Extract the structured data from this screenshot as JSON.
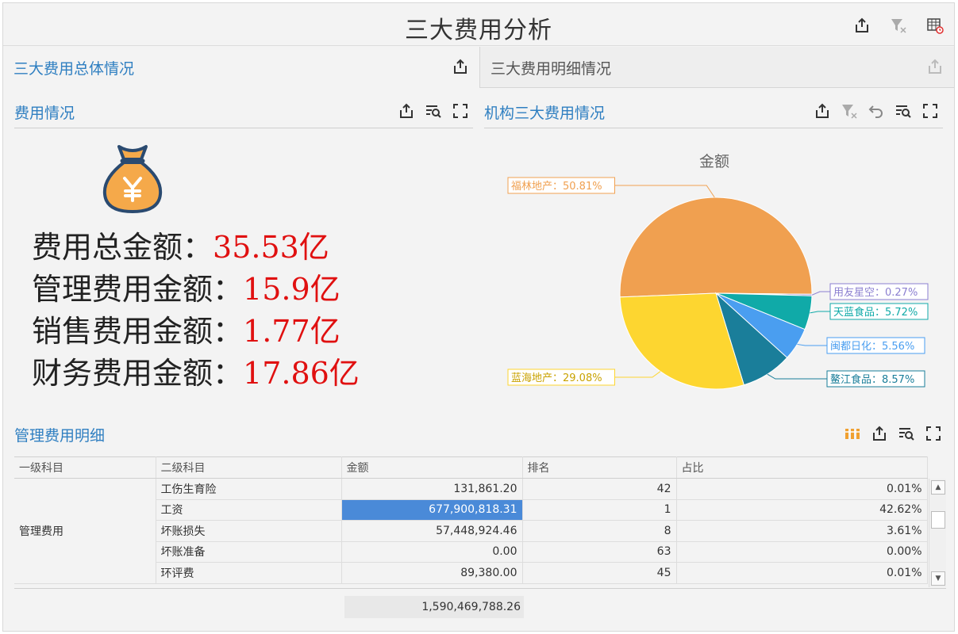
{
  "dashboard": {
    "title": "三大费用分析"
  },
  "tabs": [
    {
      "label": "三大费用总体情况",
      "active": true
    },
    {
      "label": "三大费用明细情况",
      "active": false
    }
  ],
  "left_panel": {
    "title": "费用情况",
    "icon": "money-bag-icon",
    "stats": [
      {
        "label": "费用总金额：",
        "value": "35.53亿"
      },
      {
        "label": "管理费用金额：",
        "value": "15.9亿"
      },
      {
        "label": "销售费用金额：",
        "value": "1.77亿"
      },
      {
        "label": "财务费用金额：",
        "value": "17.86亿"
      }
    ]
  },
  "right_panel": {
    "title": "机构三大费用情况"
  },
  "chart_data": {
    "type": "pie",
    "title": "金额",
    "slices": [
      {
        "name": "福林地产",
        "label": "福林地产：50.81%",
        "value": 50.81,
        "color": "#f0a050"
      },
      {
        "name": "用友星空",
        "label": "用友星空：0.27%",
        "value": 0.27,
        "color": "#8b7fd0"
      },
      {
        "name": "天蓝食品",
        "label": "天蓝食品：5.72%",
        "value": 5.72,
        "color": "#10aaa8"
      },
      {
        "name": "闽都日化",
        "label": "闽都日化：5.56%",
        "value": 5.56,
        "color": "#4a9ef0"
      },
      {
        "name": "鳌江食品",
        "label": "鳌江食品：8.57%",
        "value": 8.57,
        "color": "#1a7e9a"
      },
      {
        "name": "蓝海地产",
        "label": "蓝海地产：29.08%",
        "value": 29.08,
        "color": "#fdd630"
      }
    ]
  },
  "detail": {
    "title": "管理费用明细",
    "columns": [
      "一级科目",
      "二级科目",
      "金额",
      "排名",
      "占比"
    ],
    "group": "管理费用",
    "rows": [
      {
        "sub": "工伤生育险",
        "amount": "131,861.20",
        "rank": "42",
        "ratio": "0.01%"
      },
      {
        "sub": "工资",
        "amount": "677,900,818.31",
        "rank": "1",
        "ratio": "42.62%"
      },
      {
        "sub": "坏账损失",
        "amount": "57,448,924.46",
        "rank": "8",
        "ratio": "3.61%"
      },
      {
        "sub": "坏账准备",
        "amount": "0.00",
        "rank": "63",
        "ratio": "0.00%"
      },
      {
        "sub": "环评费",
        "amount": "89,380.00",
        "rank": "45",
        "ratio": "0.01%"
      }
    ],
    "total": "1,590,469,788.26"
  }
}
